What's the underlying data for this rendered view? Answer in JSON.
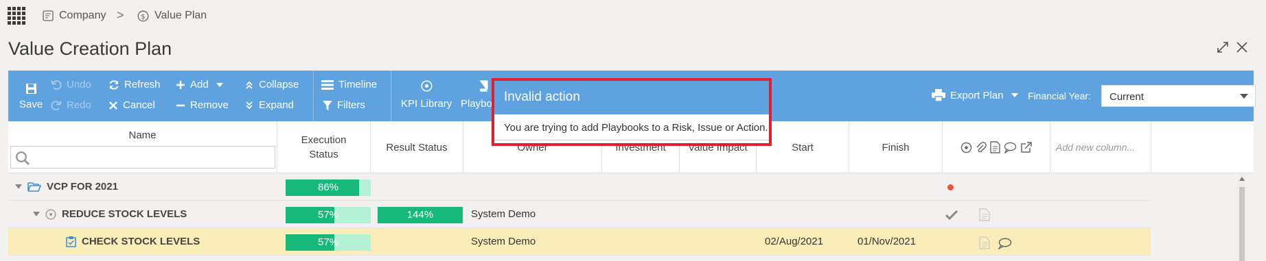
{
  "breadcrumb": {
    "company": "Company",
    "separator": ">",
    "page": "Value Plan"
  },
  "page_title": "Value Creation Plan",
  "toolbar": {
    "save": "Save",
    "undo": "Undo",
    "redo": "Redo",
    "refresh": "Refresh",
    "cancel": "Cancel",
    "add": "Add",
    "remove": "Remove",
    "collapse": "Collapse",
    "expand": "Expand",
    "timeline": "Timeline",
    "filters": "Filters",
    "kpi_library": "KPI Library",
    "playbooks": "Playbooks",
    "export_plan": "Export Plan",
    "financial_year_label": "Financial Year:",
    "financial_year_value": "Current"
  },
  "columns": {
    "name": "Name",
    "execution_status": "Execution Status",
    "result_status": "Result Status",
    "owner": "Owner",
    "investment": "Investment",
    "value_impact": "Value Impact",
    "start": "Start",
    "finish": "Finish",
    "add_column_placeholder": "Add new column..."
  },
  "rows": [
    {
      "name": "VCP FOR 2021",
      "execution": "86%",
      "execution_fraction": 0.86,
      "result": "",
      "owner": "",
      "start": "",
      "finish": ""
    },
    {
      "name": "REDUCE STOCK LEVELS",
      "execution": "57%",
      "execution_fraction": 0.57,
      "result": "144%",
      "result_fraction": 1.0,
      "owner": "System Demo",
      "start": "",
      "finish": ""
    },
    {
      "name": "CHECK STOCK LEVELS",
      "execution": "57%",
      "execution_fraction": 0.57,
      "result": "",
      "owner": "System Demo",
      "start": "02/Aug/2021",
      "finish": "01/Nov/2021"
    }
  ],
  "modal": {
    "title": "Invalid action",
    "message": "You are trying to add Playbooks to a Risk, Issue or Action."
  },
  "colors": {
    "accent": "#5ea3df",
    "progress": "#17b97b",
    "progress_bg": "#b4f2d6",
    "highlight_row": "#fbedb7",
    "alert_border": "#e0202a",
    "status_dot": "#e8553d"
  }
}
